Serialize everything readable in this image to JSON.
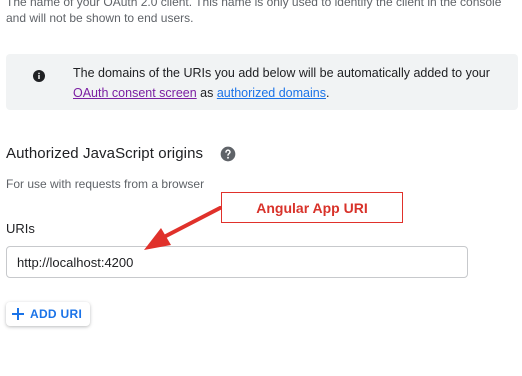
{
  "client_name_helper": "The name of your OAuth 2.0 client. This name is only used to identify the client in the console and will not be shown to end users.",
  "info_banner": {
    "text_before": "The domains of the URIs you add below will be automatically added to your ",
    "consent_link": "OAuth consent screen",
    "middle": " as ",
    "domains_link": "authorized domains",
    "end": ".",
    "icon": "info-icon"
  },
  "js_origins": {
    "title": "Authorized JavaScript origins",
    "help_icon": "help-icon",
    "description": "For use with requests from a browser",
    "uris_label": "URIs",
    "uri_value": "http://localhost:4200",
    "add_button": "ADD URI",
    "add_icon": "plus-icon"
  },
  "annotation": {
    "label": "Angular App URI",
    "color": "#e0312b"
  },
  "colors": {
    "info_bg": "#f1f3f4",
    "link_visited": "#7b1fa2",
    "link": "#1a73e8",
    "button_text": "#1a73e8"
  }
}
